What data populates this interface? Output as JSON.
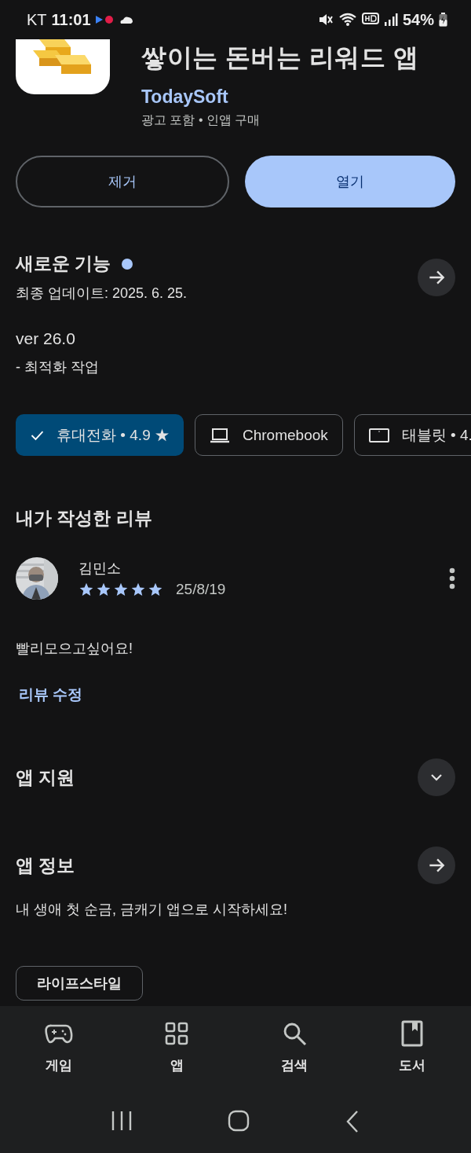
{
  "status_bar": {
    "carrier": "KT",
    "time": "11:01",
    "battery": "54%"
  },
  "app": {
    "title": "쌓이는 돈버는 리워드 앱",
    "developer": "TodaySoft",
    "meta": "광고 포함 • 인앱 구매"
  },
  "actions": [
    {
      "label": "제거",
      "kind": "outline"
    },
    {
      "label": "열기",
      "kind": "filled"
    }
  ],
  "whats_new": {
    "title": "새로운 기능",
    "new": true,
    "updated": "최종 업데이트: 2025. 6. 25.",
    "version": "ver 26.0",
    "notes": "- 최적화 작업"
  },
  "devices": [
    {
      "label": "휴대전화 • 4.9 ★",
      "selected": true
    },
    {
      "label": "Chromebook",
      "selected": false
    },
    {
      "label": "태블릿 • 4.",
      "selected": false
    }
  ],
  "my_review": {
    "title": "내가 작성한 리뷰",
    "author": "김민소",
    "stars": 5,
    "date": "25/8/19",
    "text": "빨리모으고싶어요!",
    "edit_link": "리뷰 수정"
  },
  "app_support": {
    "title": "앱 지원",
    "expanded": false
  },
  "app_info": {
    "title": "앱 정보",
    "description": "내 생애 첫 순금, 금캐기 앱으로 시작하세요!",
    "categories": [
      "라이프스타일"
    ]
  },
  "bottom_nav": [
    {
      "label": "게임",
      "selected": false
    },
    {
      "label": "앱",
      "selected": false
    },
    {
      "label": "검색",
      "selected": false
    },
    {
      "label": "도서",
      "selected": false
    }
  ]
}
